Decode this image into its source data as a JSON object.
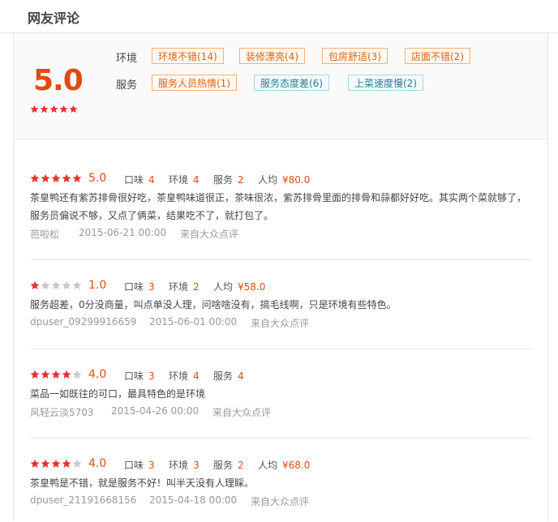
{
  "section_title": "网友评论",
  "summary": {
    "score": "5.0",
    "score_stars": 5,
    "groups": [
      {
        "label": "环境",
        "tags": [
          {
            "text": "环境不错(14)",
            "type": "pos"
          },
          {
            "text": "装修漂亮(4)",
            "type": "pos"
          },
          {
            "text": "包房舒适(3)",
            "type": "pos"
          },
          {
            "text": "店面不错(2)",
            "type": "pos"
          }
        ]
      },
      {
        "label": "服务",
        "tags": [
          {
            "text": "服务人员热情(1)",
            "type": "pos"
          },
          {
            "text": "服务态度差(6)",
            "type": "neg"
          },
          {
            "text": "上菜速度慢(2)",
            "type": "neg"
          }
        ]
      }
    ]
  },
  "reviews": [
    {
      "stars": 5,
      "score": "5.0",
      "items": [
        {
          "label": "口味",
          "value": "4"
        },
        {
          "label": "环境",
          "value": "4"
        },
        {
          "label": "服务",
          "value": "2"
        },
        {
          "label": "人均",
          "value": "¥80.0"
        }
      ],
      "text": "茶皇鸭还有紫苏排骨很好吃，茶皇鸭味道很正，茶味很浓，紫苏排骨里面的排骨和蒜都好好吃。其实两个菜就够了，服务员偏说不够，又点了俩菜，结果吃不了，就打包了。",
      "user": "芭啦松",
      "date": "2015-06-21 00:00",
      "source": "来自大众点评"
    },
    {
      "stars": 1,
      "score": "1.0",
      "items": [
        {
          "label": "口味",
          "value": "3"
        },
        {
          "label": "环境",
          "value": "2"
        },
        {
          "label": "人均",
          "value": "¥58.0"
        }
      ],
      "text": "服务超差，0分没商量，叫点单没人理，问啥啥没有，搞毛线啊，只是环境有些特色。",
      "user": "dpuser_09299916659",
      "date": "2015-06-01 00:00",
      "source": "来自大众点评"
    },
    {
      "stars": 4,
      "score": "4.0",
      "items": [
        {
          "label": "口味",
          "value": "3"
        },
        {
          "label": "环境",
          "value": "4"
        },
        {
          "label": "服务",
          "value": "4"
        }
      ],
      "text": "菜品一如既往的可口，最具特色的是环境",
      "user": "风轻云淡5703",
      "date": "2015-04-26 00:00",
      "source": "来自大众点评"
    },
    {
      "stars": 4,
      "score": "4.0",
      "items": [
        {
          "label": "口味",
          "value": "3"
        },
        {
          "label": "环境",
          "value": "3"
        },
        {
          "label": "服务",
          "value": "2"
        },
        {
          "label": "人均",
          "value": "¥68.0"
        }
      ],
      "text": "茶皇鸭是不错，就是服务不好！叫半天没有人理睬。",
      "user": "dpuser_21191668156",
      "date": "2015-04-18 00:00",
      "source": "来自大众点评"
    }
  ],
  "colors": {
    "accent": "#e34a10",
    "star_on": "#e8312f",
    "star_off": "#c8c8c8"
  }
}
